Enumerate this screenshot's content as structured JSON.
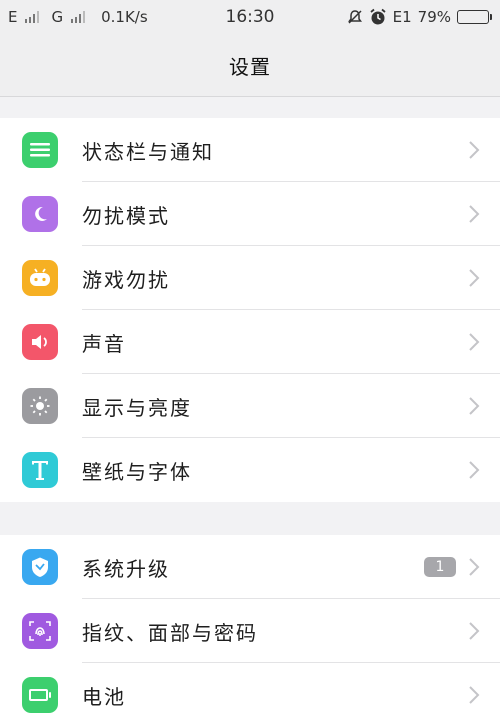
{
  "status_bar": {
    "carrier1": "E",
    "carrier2": "G",
    "speed": "0.1K/s",
    "time": "16:30",
    "network_e1": "E1",
    "battery": "79%"
  },
  "header": {
    "title": "设置"
  },
  "groups": [
    {
      "items": [
        {
          "label": "状态栏与通知",
          "icon": "status-bar-icon",
          "color": "#3ccf6e"
        },
        {
          "label": "勿扰模式",
          "icon": "moon-icon",
          "color": "#b071e8"
        },
        {
          "label": "游戏勿扰",
          "icon": "game-controller-icon",
          "color": "#f6b023"
        },
        {
          "label": "声音",
          "icon": "speaker-icon",
          "color": "#f3566a"
        },
        {
          "label": "显示与亮度",
          "icon": "brightness-icon",
          "color": "#9b9b9f"
        },
        {
          "label": "壁纸与字体",
          "icon": "font-icon",
          "color": "#2fcad6"
        }
      ]
    },
    {
      "items": [
        {
          "label": "系统升级",
          "icon": "system-update-icon",
          "color": "#39a8f0",
          "badge": "1"
        },
        {
          "label": "指纹、面部与密码",
          "icon": "fingerprint-icon",
          "color": "#a05ae0"
        },
        {
          "label": "电池",
          "icon": "battery-icon",
          "color": "#3ccf6e"
        }
      ]
    }
  ]
}
